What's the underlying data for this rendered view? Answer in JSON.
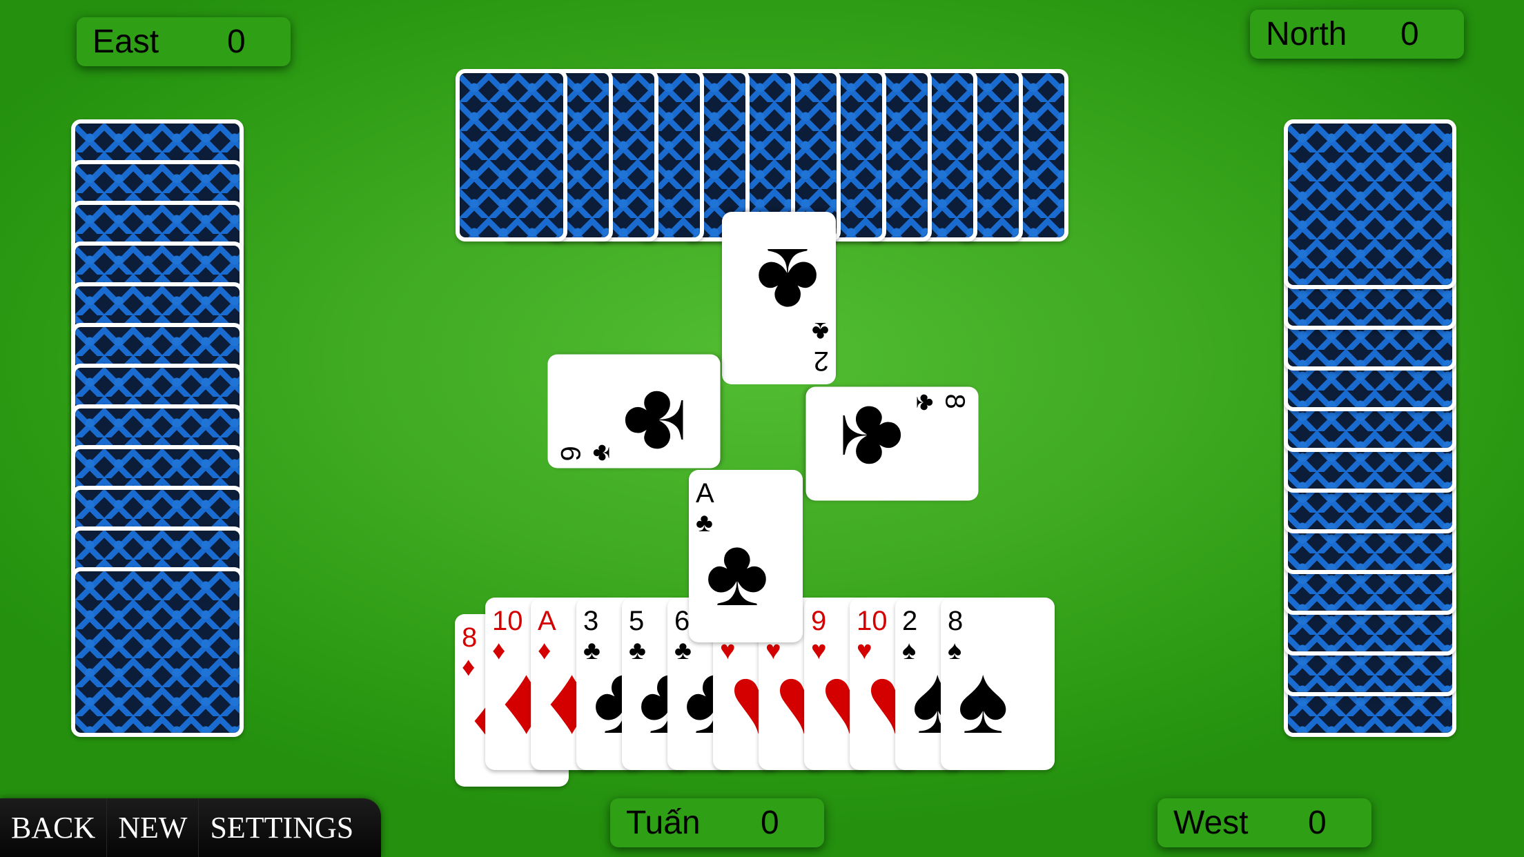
{
  "players": {
    "east": {
      "name": "East",
      "score": "0"
    },
    "north": {
      "name": "North",
      "score": "0"
    },
    "south": {
      "name": "Tuấn",
      "score": "0"
    },
    "west": {
      "name": "West",
      "score": "0"
    }
  },
  "nav": {
    "back_label": "BACK",
    "new_label": "NEW",
    "settings_label": "SETTINGS"
  },
  "opponent_hands": {
    "north_count": 12,
    "east_count": 12,
    "west_count": 12
  },
  "trick": {
    "north": {
      "rank": "2",
      "suit": "♣",
      "color": "black"
    },
    "east": {
      "rank": "9",
      "suit": "♣",
      "color": "black"
    },
    "west": {
      "rank": "8",
      "suit": "♣",
      "color": "black"
    },
    "south": {
      "rank": "A",
      "suit": "♣",
      "color": "black"
    }
  },
  "hand": [
    {
      "rank": "8",
      "suit": "♦",
      "color": "red"
    },
    {
      "rank": "10",
      "suit": "♦",
      "color": "red"
    },
    {
      "rank": "A",
      "suit": "♦",
      "color": "red"
    },
    {
      "rank": "3",
      "suit": "♣",
      "color": "black"
    },
    {
      "rank": "5",
      "suit": "♣",
      "color": "black"
    },
    {
      "rank": "6",
      "suit": "♣",
      "color": "black"
    },
    {
      "rank": "",
      "suit": "♥",
      "color": "red"
    },
    {
      "rank": "",
      "suit": "♥",
      "color": "red"
    },
    {
      "rank": "9",
      "suit": "♥",
      "color": "red"
    },
    {
      "rank": "10",
      "suit": "♥",
      "color": "red"
    },
    {
      "rank": "2",
      "suit": "♠",
      "color": "black"
    },
    {
      "rank": "8",
      "suit": "♠",
      "color": "black"
    }
  ],
  "colors": {
    "table_center": "#52bd32",
    "table_edge": "#24900e",
    "score_box": "#2f9f15",
    "card_back_blue": "#1a6bd0",
    "card_back_navy": "#0b1d38",
    "red_suit": "#d40000"
  }
}
